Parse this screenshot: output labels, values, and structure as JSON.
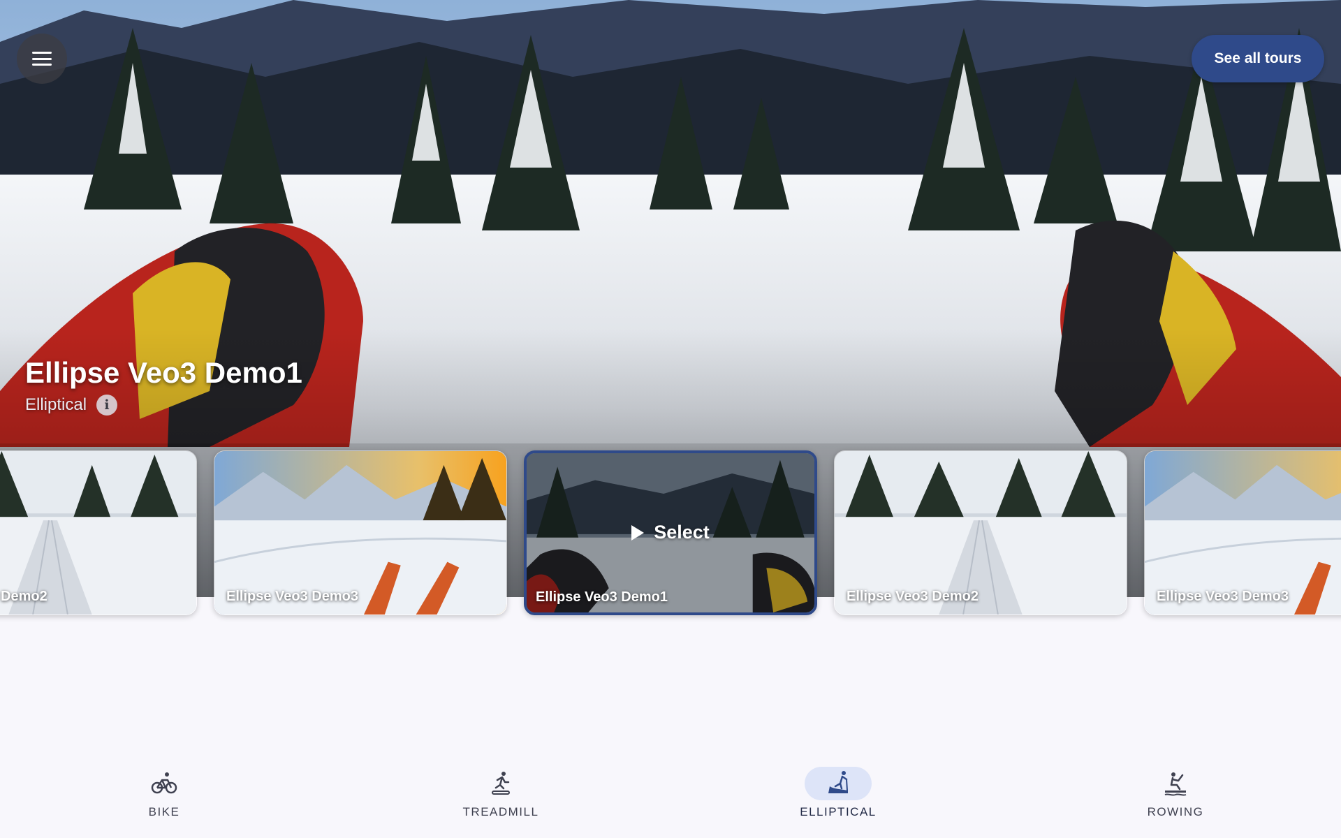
{
  "header": {
    "menu_icon": "hamburger-menu-icon",
    "see_all_label": "See all tours"
  },
  "hero": {
    "title": "Ellipse Veo3 Demo1",
    "category": "Elliptical",
    "info_icon": "info-icon"
  },
  "carousel": {
    "cards": [
      {
        "title": "Demo2",
        "scene": "forest-trail",
        "selected": false
      },
      {
        "title": "Ellipse Veo3 Demo3",
        "scene": "sunset-skis",
        "selected": false
      },
      {
        "title": "Ellipse Veo3 Demo1",
        "scene": "snowy-forest-poles",
        "selected": true
      },
      {
        "title": "Ellipse Veo3 Demo2",
        "scene": "forest-trail",
        "selected": false
      },
      {
        "title": "Ellipse Veo3 Demo3",
        "scene": "sunset-skis",
        "selected": false
      }
    ],
    "select_label": "Select",
    "play_icon": "play-icon"
  },
  "nav": {
    "items": [
      {
        "label": "BIKE",
        "icon": "bike-icon",
        "active": false
      },
      {
        "label": "TREADMILL",
        "icon": "treadmill-icon",
        "active": false
      },
      {
        "label": "ELLIPTICAL",
        "icon": "elliptical-icon",
        "active": true
      },
      {
        "label": "ROWING",
        "icon": "rowing-icon",
        "active": false
      }
    ]
  },
  "colors": {
    "accent": "#2f4a8a",
    "active_pill": "#dde4f8",
    "background": "#f8f7fc"
  }
}
